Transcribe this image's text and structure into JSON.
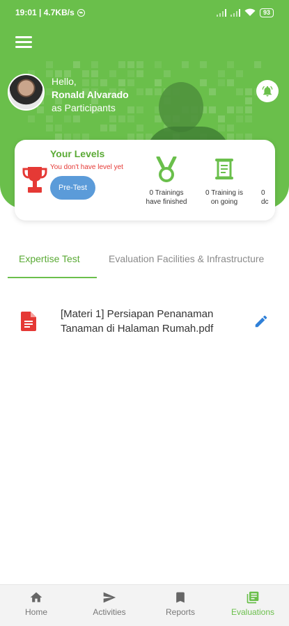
{
  "status_bar": {
    "time": "19:01",
    "network_speed": "4.7KB/s",
    "battery": "93"
  },
  "user": {
    "hello": "Hello,",
    "name": "Ronald Alvarado",
    "role": "as Participants"
  },
  "levels": {
    "title": "Your Levels",
    "subtitle": "You don't have level yet",
    "pretest_button": "Pre-Test",
    "stats": [
      {
        "count": "0 Trainings",
        "label": "have finished"
      },
      {
        "count": "0 Training is",
        "label": "on going"
      },
      {
        "count": "0",
        "label": "dc"
      }
    ]
  },
  "tabs": [
    {
      "label": "Expertise Test",
      "active": true
    },
    {
      "label": "Evaluation Facilities & Infrastructure",
      "active": false
    }
  ],
  "files": [
    {
      "name": "[Materi 1] Persiapan Penanaman Tanaman di Halaman Rumah.pdf",
      "type": "pdf"
    }
  ],
  "bottom_nav": [
    {
      "label": "Home",
      "icon": "home-icon",
      "active": false
    },
    {
      "label": "Activities",
      "icon": "paper-plane-icon",
      "active": false
    },
    {
      "label": "Reports",
      "icon": "bookmark-icon",
      "active": false
    },
    {
      "label": "Evaluations",
      "icon": "document-list-icon",
      "active": true
    }
  ],
  "colors": {
    "primary_green": "#6abf4b",
    "pretest_blue": "#5b9bd9",
    "danger_red": "#e53935",
    "edit_blue": "#2f80d8"
  }
}
